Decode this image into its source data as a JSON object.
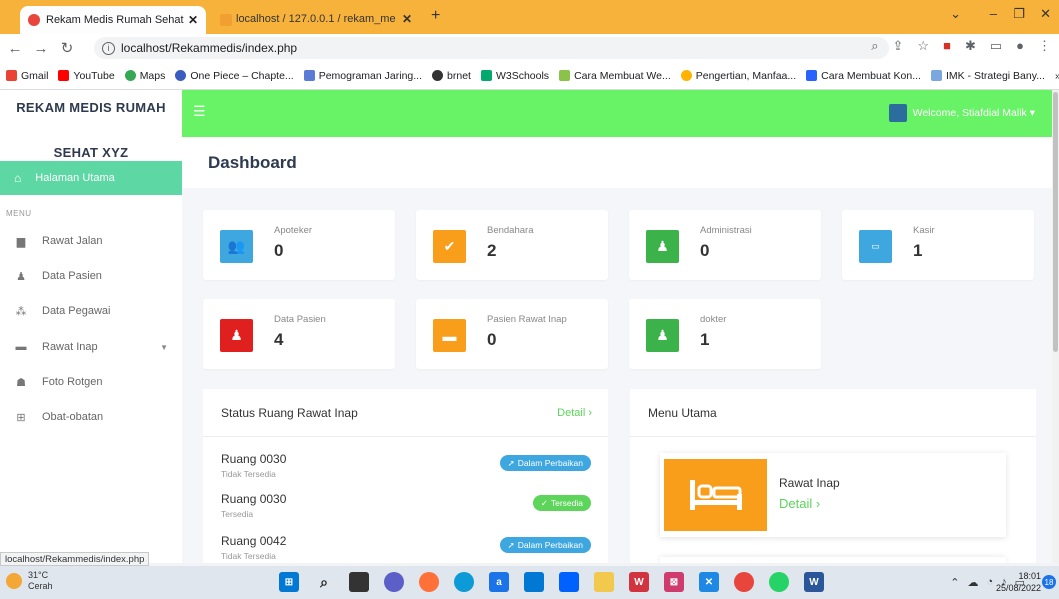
{
  "browser": {
    "tabs": [
      {
        "title": "Rekam Medis Rumah Sehat XYZ",
        "active": true
      },
      {
        "title": "localhost / 127.0.0.1 / rekam_me",
        "active": false
      }
    ],
    "url": "localhost/Rekammedis/index.php",
    "bookmarks": [
      "Gmail",
      "YouTube",
      "Maps",
      "One Piece – Chapte...",
      "Pemograman Jaring...",
      "brnet",
      "W3Schools",
      "Cara Membuat We...",
      "Pengertian, Manfaa...",
      "Cara Membuat Kon...",
      "IMK - Strategi Bany..."
    ],
    "status_url": "localhost/Rekammedis/index.php"
  },
  "brand": {
    "line1": "REKAM MEDIS RUMAH",
    "line2": "SEHAT XYZ"
  },
  "sidebar": {
    "active": "Halaman Utama",
    "menu_label": "MENU",
    "items": [
      "Rawat Jalan",
      "Data Pasien",
      "Data Pegawai",
      "Rawat Inap",
      "Foto Rotgen",
      "Obat-obatan"
    ]
  },
  "topnav": {
    "user": "Welcome, Stiafdial Malik ▾"
  },
  "page_title": "Dashboard",
  "cards": [
    {
      "label": "Apoteker",
      "value": "0",
      "color": "#3fa7e0"
    },
    {
      "label": "Bendahara",
      "value": "2",
      "color": "#f89e1b"
    },
    {
      "label": "Administrasi",
      "value": "0",
      "color": "#3cb34a"
    },
    {
      "label": "Kasir",
      "value": "1",
      "color": "#3fa7e0"
    },
    {
      "label": "Data Pasien",
      "value": "4",
      "color": "#e01f1f"
    },
    {
      "label": "Pasien Rawat Inap",
      "value": "0",
      "color": "#f89e1b"
    },
    {
      "label": "dokter",
      "value": "1",
      "color": "#3cb34a"
    }
  ],
  "status_panel": {
    "title": "Status Ruang Rawat Inap",
    "detail": "Detail",
    "rooms": [
      {
        "name": "Ruang 0030",
        "status": "Tidak Tersedia",
        "badge": "Dalam Perbaikan",
        "type": "repair"
      },
      {
        "name": "Ruang 0030",
        "status": "Tersedia",
        "badge": "Tersedia",
        "type": "ok"
      },
      {
        "name": "Ruang 0042",
        "status": "Tidak Tersedia",
        "badge": "Dalam Perbaikan",
        "type": "repair"
      }
    ]
  },
  "menu_panel": {
    "title": "Menu Utama",
    "item_label": "Rawat Inap",
    "item_detail": "Detail"
  },
  "taskbar": {
    "weather_temp": "31°C",
    "weather_desc": "Cerah",
    "time": "18:01",
    "date": "25/08/2022",
    "notifications": "18"
  }
}
